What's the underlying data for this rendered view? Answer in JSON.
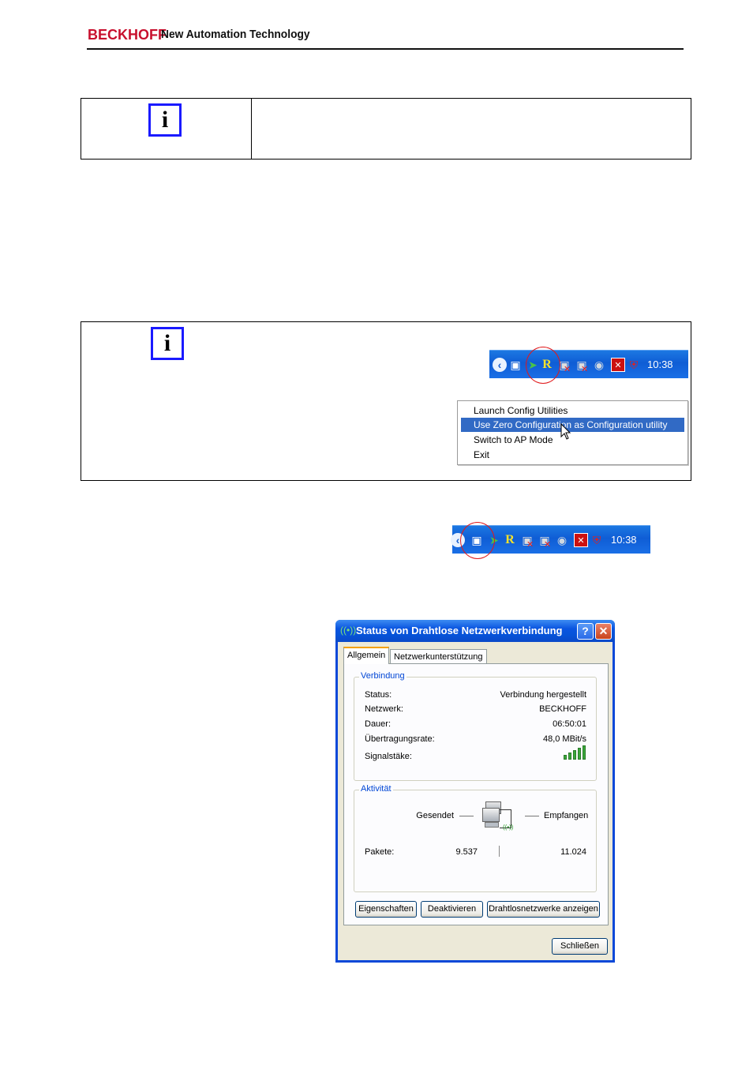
{
  "header": {
    "brand": "BECKHOFF",
    "tagline": "New Automation Technology"
  },
  "tray_top": {
    "chevron": "‹",
    "clock": "10:38",
    "icons": [
      "wireless-network-icon",
      "network-arrow-icon",
      "ralink-r-icon",
      "network-disconnected-icon",
      "network-disconnected-icon",
      "speaker-icon",
      "security-alert-icon",
      "shield-icon"
    ]
  },
  "context_menu": {
    "items": [
      {
        "label": "Launch Config Utilities",
        "selected": false
      },
      {
        "label": "Use Zero Configuration as Configuration utility",
        "selected": true
      },
      {
        "label": "Switch to AP Mode",
        "selected": false
      },
      {
        "label": "Exit",
        "selected": false
      }
    ]
  },
  "tray_bottom": {
    "chevron": "‹",
    "clock": "10:38"
  },
  "dialog": {
    "title": "Status von Drahtlose Netzwerkverbindung",
    "help": "?",
    "close": "✕",
    "tabs": [
      "Allgemein",
      "Netzwerkunterstützung"
    ],
    "connection": {
      "legend": "Verbindung",
      "rows": [
        {
          "label": "Status:",
          "value": "Verbindung hergestellt"
        },
        {
          "label": "Netzwerk:",
          "value": "BECKHOFF"
        },
        {
          "label": "Dauer:",
          "value": "06:50:01"
        },
        {
          "label": "Übertragungsrate:",
          "value": "48,0 MBit/s"
        }
      ],
      "signal_label": "Signalstäke:",
      "signal_bars": 5
    },
    "activity": {
      "legend": "Aktivität",
      "sent_label": "Gesendet",
      "received_label": "Empfangen",
      "packets_label": "Pakete:",
      "sent_packets": "9.537",
      "received_packets": "11.024"
    },
    "buttons": {
      "properties": "Eigenschaften",
      "disable": "Deaktivieren",
      "show_networks": "Drahtlosnetzwerke anzeigen",
      "close": "Schließen"
    }
  }
}
